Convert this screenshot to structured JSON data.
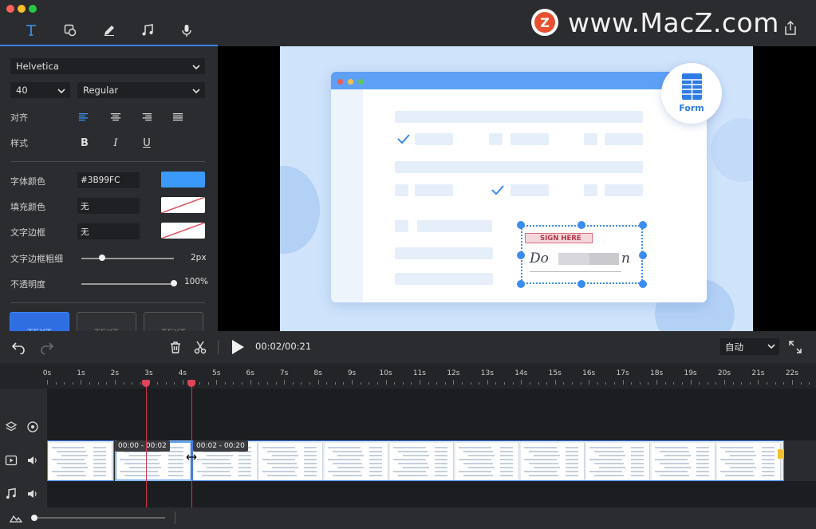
{
  "watermark": {
    "logo_letter": "Z",
    "text": "www.MacZ.com"
  },
  "toolbar": {
    "tabs": [
      {
        "name": "text-tool-tab",
        "icon": "text-icon"
      },
      {
        "name": "shape-tool-tab",
        "icon": "shapes-icon"
      },
      {
        "name": "pen-tool-tab",
        "icon": "pencil-icon"
      },
      {
        "name": "music-tool-tab",
        "icon": "music-note-icon"
      },
      {
        "name": "record-tool-tab",
        "icon": "microphone-icon"
      }
    ],
    "active_tab": "text-tool-tab",
    "accent": "#3B82F6"
  },
  "properties": {
    "font_family": "Helvetica",
    "font_size": "40",
    "font_weight": "Regular",
    "align_label": "对齐",
    "style_label": "样式",
    "style_buttons": {
      "bold": "B",
      "italic": "I",
      "underline": "U"
    },
    "font_color_label": "字体颜色",
    "font_color_value": "#3B99FC",
    "font_color": "#3B99FC",
    "fill_color_label": "填充颜色",
    "fill_color_value": "无",
    "border_label": "文字边框",
    "border_value": "无",
    "border_width_label": "文字边框粗细",
    "border_width_value": "2px",
    "border_width_fraction": 0.22,
    "opacity_label": "不透明度",
    "opacity_value": "100%",
    "opacity_fraction": 1.0,
    "presets": [
      "TEXT",
      "TEXT",
      "TEXT"
    ]
  },
  "preview": {
    "form_badge_label": "Form",
    "sign_tag": "SIGN HERE",
    "signature_visible": "Do",
    "signature_end": "n"
  },
  "controls": {
    "timecode": "00:02/00:21",
    "zoom_value": "自动"
  },
  "timeline": {
    "ticks": [
      "0s",
      "1s",
      "2s",
      "3s",
      "4s",
      "5s",
      "6s",
      "7s",
      "8s",
      "9s",
      "10s",
      "11s",
      "12s",
      "13s",
      "14s",
      "15s",
      "16s",
      "17s",
      "18s",
      "19s",
      "20s",
      "21s",
      "22s"
    ],
    "clip_times": [
      "00:00 - 00:02",
      "00:02 - 00:20"
    ]
  }
}
